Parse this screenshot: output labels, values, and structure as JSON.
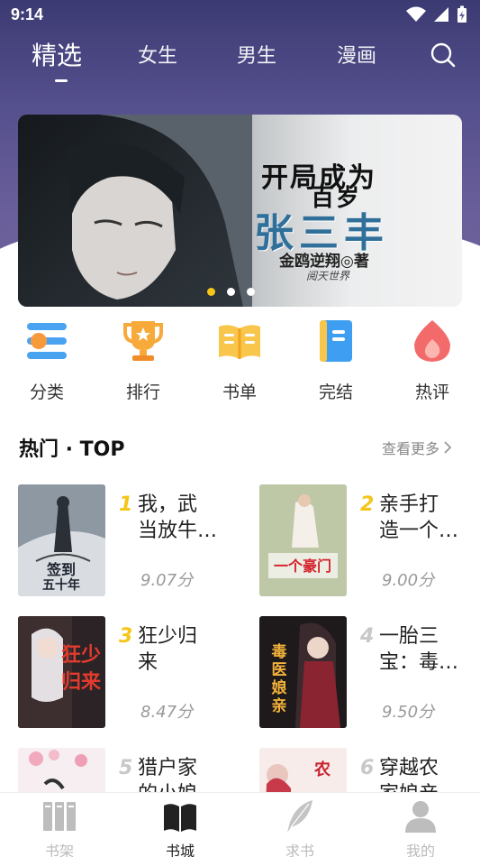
{
  "status_bar": {
    "time": "9:14"
  },
  "top_tabs": [
    {
      "label": "精选",
      "active": true
    },
    {
      "label": "女生",
      "active": false
    },
    {
      "label": "男生",
      "active": false
    },
    {
      "label": "漫画",
      "active": false
    }
  ],
  "banner": {
    "title_line1": "开局成为",
    "title_line2": "百岁",
    "title_big": "张三丰",
    "author": "金鸥逆翔◎著",
    "publisher": "阅天世界",
    "page_count": 3,
    "active_page": 1
  },
  "categories": [
    {
      "label": "分类",
      "icon": "category-icon"
    },
    {
      "label": "排行",
      "icon": "trophy-icon"
    },
    {
      "label": "书单",
      "icon": "booklist-icon"
    },
    {
      "label": "完结",
      "icon": "finished-book-icon"
    },
    {
      "label": "热评",
      "icon": "flame-icon"
    }
  ],
  "section": {
    "title": "热门 · TOP",
    "more": "查看更多"
  },
  "books": [
    {
      "rank": "1",
      "title_l1": "我，武",
      "title_l2": "当放牛…",
      "score": "9.07分",
      "cover_text": "签到五十年"
    },
    {
      "rank": "2",
      "title_l1": "亲手打",
      "title_l2": "造一个…",
      "score": "9.00分",
      "cover_text": "一个豪门"
    },
    {
      "rank": "3",
      "title_l1": "狂少归",
      "title_l2": "来",
      "score": "8.47分",
      "cover_text": "狂少归来"
    },
    {
      "rank": "4",
      "title_l1": "一胎三",
      "title_l2": "宝：毒…",
      "score": "9.50分",
      "cover_text": "毒医娘亲"
    },
    {
      "rank": "5",
      "title_l1": "猎户家",
      "title_l2": "的小娘",
      "score": "",
      "cover_text": ""
    },
    {
      "rank": "6",
      "title_l1": "穿越农",
      "title_l2": "家娘亲",
      "score": "",
      "cover_text": ""
    }
  ],
  "bottom_nav": [
    {
      "label": "书架",
      "icon": "bookshelf-icon",
      "active": false
    },
    {
      "label": "书城",
      "icon": "open-book-icon",
      "active": true
    },
    {
      "label": "求书",
      "icon": "feather-icon",
      "active": false
    },
    {
      "label": "我的",
      "icon": "user-icon",
      "active": false
    }
  ],
  "colors": {
    "accent": "#f5c518",
    "header_top": "#3c3a72",
    "header_bottom": "#6f6299"
  }
}
